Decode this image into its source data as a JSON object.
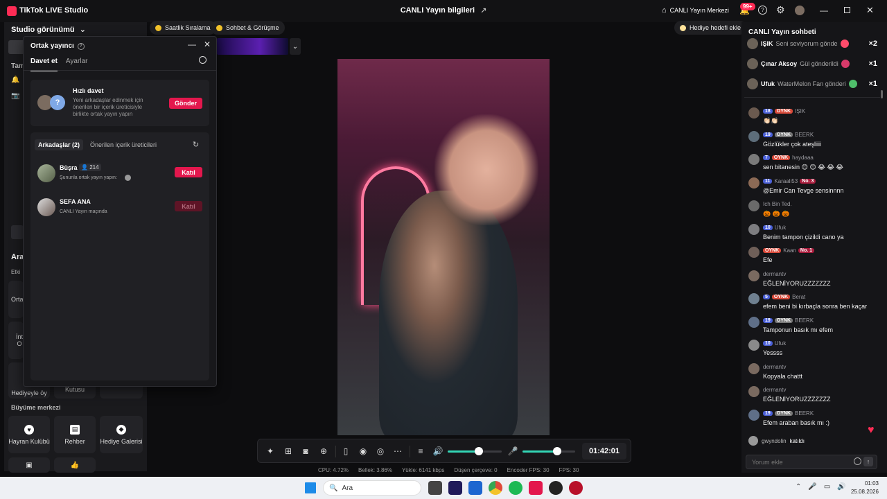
{
  "titlebar": {
    "app_name": "TikTok LIVE Studio",
    "center_title": "CANLI Yayın bilgileri",
    "live_center": "CANLI Yayın Merkezi",
    "notif_badge": "99+"
  },
  "left": {
    "studio_view": "Studio görünümü",
    "growth_center": "Büyüme merkezi",
    "tools": [
      {
        "label": "Hayran Kulübü"
      },
      {
        "label": "Rehber"
      },
      {
        "label": "Hediye Galerisi"
      }
    ],
    "partial_labels": {
      "tam": "Tam",
      "ara": "Ara",
      "etki": "Etki",
      "orta": "Orta",
      "int_o": "İnt O",
      "hediyeyle": "Hediyeyle öy",
      "kutusu": "Kutusu",
      "a": "A"
    }
  },
  "chips": {
    "hourly": "Saatlik Sıralama",
    "chat_meet": "Sohbet & Görüşme",
    "gift_goal": "Hediye hedefi ekle"
  },
  "modal": {
    "title": "Ortak yayıncı",
    "tabs": [
      "Davet et",
      "Ayarlar"
    ],
    "quick_invite_title": "Hızlı davet",
    "quick_invite_desc": "Yeni arkadaşlar edinmek için önerilen bir içerik üreticisiyle birlikte ortak yayın yapın",
    "send_label": "Gönder",
    "subtabs": [
      "Arkadaşlar (2)",
      "Önerilen içerik üreticileri"
    ],
    "friends": [
      {
        "name": "Büşra",
        "count": "214",
        "status": "Şununla ortak yayın yapın:",
        "button": "Katıl"
      },
      {
        "name": "SEFA ANA",
        "status": "CANLI Yayın maçında",
        "button": "Katıl"
      }
    ]
  },
  "controls": {
    "timer": "01:42:01",
    "volume_level": 0.58,
    "mic_level": 0.66
  },
  "stats": [
    "CPU:  4.72%",
    "Bellek:  3.86%",
    "Yükle:  6141 kbps",
    "Düşen çerçeve:  0",
    "Encoder FPS:  30",
    "FPS:  30"
  ],
  "chat": {
    "title": "CANLI Yayın sohbeti",
    "gifts": [
      {
        "user": "IŞIK",
        "text": "Seni seviyorum gönde",
        "mult": "×2"
      },
      {
        "user": "Çınar Aksoy",
        "text": "Gül gönderildi",
        "mult": "×1"
      },
      {
        "user": "Ufuk",
        "text": "WaterMelon Fan gönderi",
        "mult": "×1"
      }
    ],
    "messages": [
      {
        "level": "18",
        "fan": "OYNK",
        "user": "IŞIK",
        "text": "👏🏻👏🏻"
      },
      {
        "level": "19",
        "fan": "OYNK",
        "fan_gray": true,
        "user": "BEERK",
        "text": "Gözlükler çok ateşliiii"
      },
      {
        "level": "7",
        "fan": "OYNK",
        "user": "haydaaa",
        "text": "sen bitanesin 😊 😊 😂 😂 😂"
      },
      {
        "level": "11",
        "user": "Karaali53",
        "rank": "No. 3",
        "text": "@Emir Can Tevge sensinnnn"
      },
      {
        "user": "Ich Bin Ted.",
        "text": "🎃 🎃 🎃"
      },
      {
        "level": "10",
        "user": "Ufuk",
        "text": "Benim tampon çizildi cano ya"
      },
      {
        "fan": "OYNK",
        "user": "Kaan",
        "rank": "No. 1",
        "text": "Efe"
      },
      {
        "user": "dermantv",
        "text": "EĞLENİYORUZZZZZZZ"
      },
      {
        "level": "5",
        "fan": "OYNK",
        "user": "Berat",
        "text": "efem beni bi kırbaçla sonra ben kaçar"
      },
      {
        "level": "19",
        "fan": "OYNK",
        "fan_gray": true,
        "user": "BEERK",
        "text": "Tamponun basık mı efem"
      },
      {
        "level": "10",
        "user": "Ufuk",
        "text": "Yessss"
      },
      {
        "user": "dermantv",
        "text": "Kopyala chattt"
      },
      {
        "user": "dermantv",
        "text": "EĞLENİYORUZZZZZZZ"
      },
      {
        "level": "19",
        "fan": "OYNK",
        "fan_gray": true,
        "user": "BEERK",
        "text": "Efem araban basık mı :)"
      }
    ],
    "joined": {
      "user": "gwyndolin",
      "text": "katıldı"
    },
    "input_placeholder": "Yorum ekle"
  },
  "taskbar": {
    "search_placeholder": "Ara",
    "time": "01:03",
    "date": "25.08.2026"
  }
}
